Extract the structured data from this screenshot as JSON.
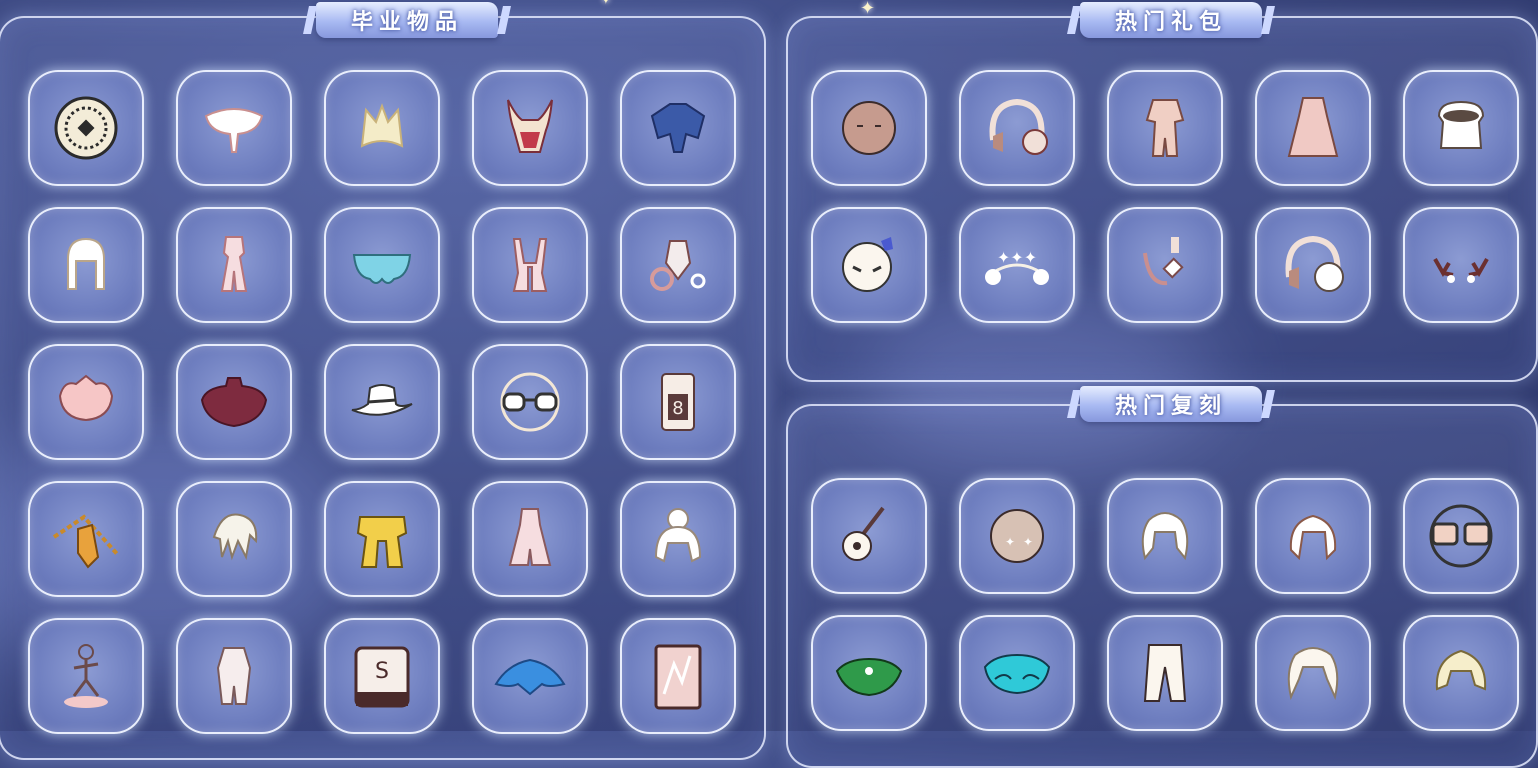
{
  "sections": {
    "graduation": {
      "title": "毕业物品",
      "items": [
        {
          "icon": "medallion-icon"
        },
        {
          "icon": "white-cape-icon"
        },
        {
          "icon": "cream-hair-icon"
        },
        {
          "icon": "red-mask-icon"
        },
        {
          "icon": "blue-cape-icon"
        },
        {
          "icon": "white-hair-icon"
        },
        {
          "icon": "pink-outfit-icon"
        },
        {
          "icon": "cyan-cape-icon"
        },
        {
          "icon": "pink-scarf-icon"
        },
        {
          "icon": "mask-prop-icon"
        },
        {
          "icon": "pink-cape-icon"
        },
        {
          "icon": "maroon-cape-icon"
        },
        {
          "icon": "cowboy-hat-icon"
        },
        {
          "icon": "glasses-icon"
        },
        {
          "icon": "music-box-icon"
        },
        {
          "icon": "golden-necklace-icon"
        },
        {
          "icon": "feather-hair-icon"
        },
        {
          "icon": "golden-scarf-icon"
        },
        {
          "icon": "pink-dress-icon"
        },
        {
          "icon": "bun-hair-icon"
        },
        {
          "icon": "dance-emote-icon"
        },
        {
          "icon": "white-armor-icon"
        },
        {
          "icon": "piano-icon"
        },
        {
          "icon": "blue-wing-cape-icon"
        },
        {
          "icon": "card-prop-icon"
        }
      ]
    },
    "hot_packs": {
      "title": "热门礼包",
      "items": [
        {
          "icon": "plain-mask-icon"
        },
        {
          "icon": "headphones-icon"
        },
        {
          "icon": "pink-pajamas-icon"
        },
        {
          "icon": "pink-robe-icon"
        },
        {
          "icon": "white-fur-icon"
        },
        {
          "icon": "white-mask-icon"
        },
        {
          "icon": "moon-crown-icon"
        },
        {
          "icon": "earring-icon"
        },
        {
          "icon": "white-headphones-icon"
        },
        {
          "icon": "antlers-icon"
        }
      ]
    },
    "hot_reruns": {
      "title": "热门复刻",
      "items": [
        {
          "icon": "guitar-icon"
        },
        {
          "icon": "star-mask-icon"
        },
        {
          "icon": "twin-tail-hair-icon"
        },
        {
          "icon": "pigtail-hair-icon"
        },
        {
          "icon": "sunglasses-icon"
        },
        {
          "icon": "green-cape-icon"
        },
        {
          "icon": "cyan-wave-cape-icon"
        },
        {
          "icon": "white-pants-icon"
        },
        {
          "icon": "wavy-hair-icon"
        },
        {
          "icon": "short-hair-icon"
        }
      ]
    }
  }
}
